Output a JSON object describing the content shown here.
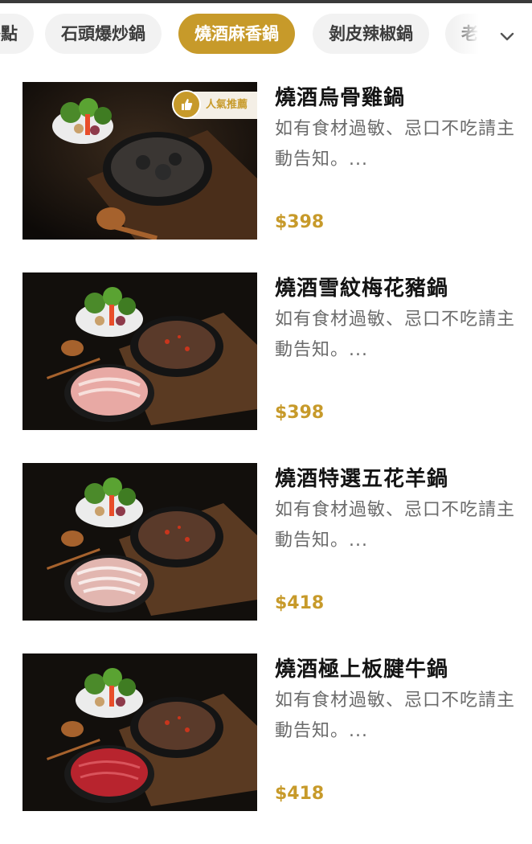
{
  "tabs": [
    {
      "label": "餐點",
      "active": false
    },
    {
      "label": "石頭爆炒鍋",
      "active": false
    },
    {
      "label": "燒酒麻香鍋",
      "active": true
    },
    {
      "label": "剝皮辣椒鍋",
      "active": false
    },
    {
      "label": "老字",
      "active": false
    }
  ],
  "more_icon": "chevron-down-icon",
  "badge": {
    "label": "人氣推薦",
    "icon": "thumbs-up-icon"
  },
  "colors": {
    "accent": "#c79a2a",
    "tab_bg": "#f2f2f2",
    "price": "#c79a2a"
  },
  "items": [
    {
      "name": "燒酒烏骨雞鍋",
      "desc": "如有食材過敏、忌口不吃請主動告知。...",
      "price": "$398",
      "meat": "black-chicken"
    },
    {
      "name": "燒酒雪紋梅花豬鍋",
      "desc": "如有食材過敏、忌口不吃請主動告知。...",
      "price": "$398",
      "meat": "pork"
    },
    {
      "name": "燒酒特選五花羊鍋",
      "desc": "如有食材過敏、忌口不吃請主動告知。...",
      "price": "$418",
      "meat": "lamb"
    },
    {
      "name": "燒酒極上板腱牛鍋",
      "desc": "如有食材過敏、忌口不吃請主動告知。...",
      "price": "$418",
      "meat": "beef"
    }
  ]
}
